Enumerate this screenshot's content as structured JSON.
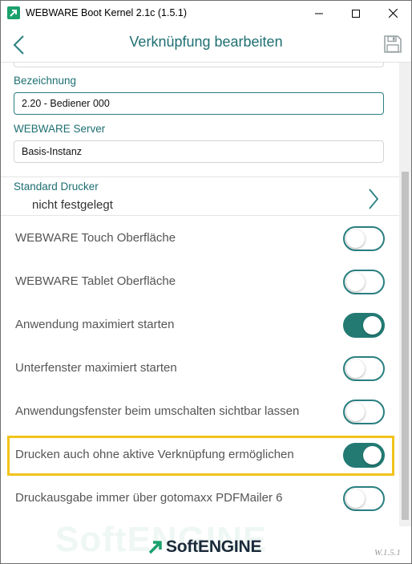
{
  "window": {
    "title": "WEBWARE Boot Kernel 2.1c (1.5.1)",
    "icons": [
      "app-logo-icon",
      "minimize-icon",
      "maximize-icon",
      "close-icon"
    ]
  },
  "header": {
    "title": "Verknüpfung bearbeiten",
    "icons": [
      "back-chevron-icon",
      "save-disk-icon"
    ],
    "accent_color": "#1e6f72"
  },
  "form": {
    "bezeichnung_label": "Bezeichnung",
    "bezeichnung_value": "2.20 - Bediener 000",
    "server_label": "WEBWARE Server",
    "server_value": "Basis-Instanz"
  },
  "printer": {
    "label": "Standard Drucker",
    "value": "nicht festgelegt"
  },
  "toggles": [
    {
      "label": "WEBWARE Touch Oberfläche",
      "on": false
    },
    {
      "label": "WEBWARE Tablet Oberfläche",
      "on": false
    },
    {
      "label": "Anwendung maximiert starten",
      "on": true
    },
    {
      "label": "Unterfenster maximiert starten",
      "on": false
    },
    {
      "label": "Anwendungsfenster beim umschalten sichtbar lassen",
      "on": false
    },
    {
      "label": "Drucken auch ohne aktive Verknüpfung ermöglichen",
      "on": true,
      "highlighted": true
    },
    {
      "label": "Druckausgabe immer über gotomaxx PDFMailer 6",
      "on": false
    }
  ],
  "footer": {
    "brand": "SoftENGINE",
    "watermark": "SoftENGINE",
    "version": "W.1.5.1"
  },
  "colors": {
    "toggle_on": "#227a73",
    "highlight": "#f2c31a"
  }
}
